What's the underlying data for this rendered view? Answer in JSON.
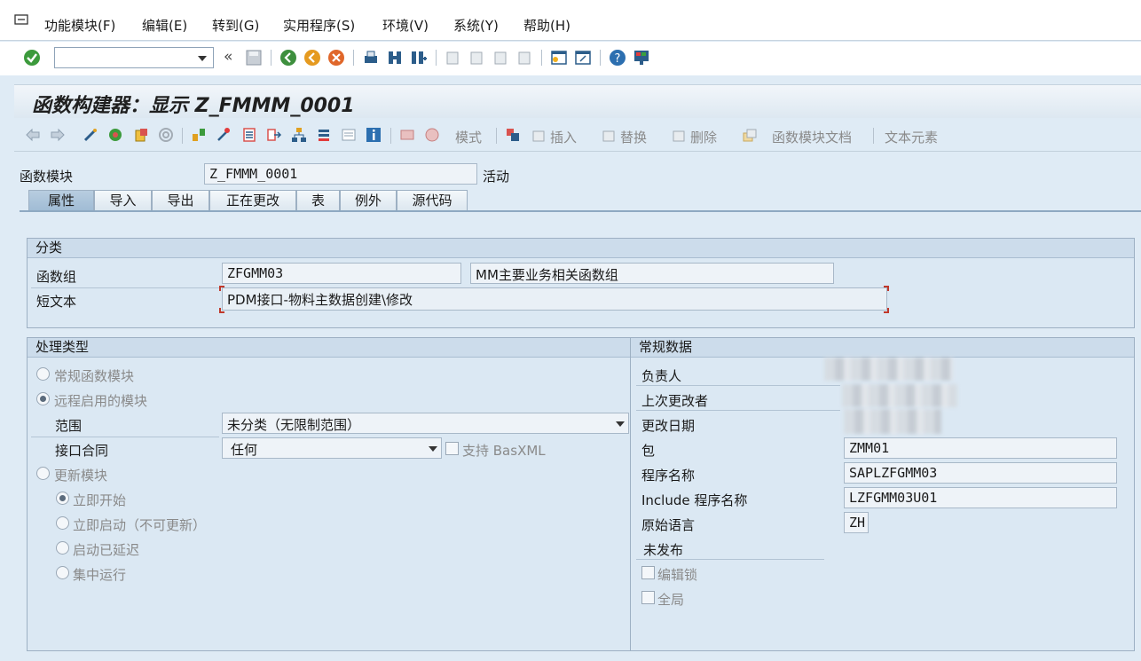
{
  "menu": {
    "items": [
      "功能模块(F)",
      "编辑(E)",
      "转到(G)",
      "实用程序(S)",
      "环境(V)",
      "系统(Y)",
      "帮助(H)"
    ]
  },
  "toolbar": {
    "command_value": "",
    "back_glyph": "«"
  },
  "title": "函数构建器：显示 Z_FMMM_0001",
  "app_toolbar": {
    "mode_label": "模式",
    "insert_label": "插入",
    "replace_label": "替换",
    "delete_label": "删除",
    "fm_doc_label": "函数模块文档",
    "text_elements_label": "文本元素"
  },
  "header": {
    "fm_label": "函数模块",
    "fm_value": "Z_FMMM_0001",
    "status": "活动"
  },
  "tabs": [
    "属性",
    "导入",
    "导出",
    "正在更改",
    "表",
    "例外",
    "源代码"
  ],
  "classification": {
    "title": "分类",
    "group_label": "函数组",
    "group_value": "ZFGMM03",
    "group_desc": "MM主要业务相关函数组",
    "short_text_label": "短文本",
    "short_text_value": "PDM接口-物料主数据创建\\修改"
  },
  "processing": {
    "title": "处理类型",
    "normal": "常规函数模块",
    "remote": "远程启用的模块",
    "scope_label": "范围",
    "scope_value": "未分类（无限制范围）",
    "contract_label": "接口合同",
    "contract_value": "任何",
    "basxml_label": "支持 BasXML",
    "update": "更新模块",
    "start_immediately": "立即开始",
    "start_immediately_no_update": "立即启动（不可更新）",
    "start_delayed": "启动已延迟",
    "collective_run": "集中运行"
  },
  "general": {
    "title": "常规数据",
    "responsible_label": "负责人",
    "last_changed_by_label": "上次更改者",
    "changed_on_label": "更改日期",
    "package_label": "包",
    "package_value": "ZMM01",
    "program_label": "程序名称",
    "program_value": "SAPLZFGMM03",
    "include_label": "Include 程序名称",
    "include_value": "LZFGMM03U01",
    "language_label": "原始语言",
    "language_value": "ZH",
    "not_released": "未发布",
    "edit_lock_label": "编辑锁",
    "global_label": "全局"
  },
  "colors": {
    "background": "#dfebf5",
    "tab_active": "#a9c3da",
    "group_header": "#ccdceb"
  }
}
